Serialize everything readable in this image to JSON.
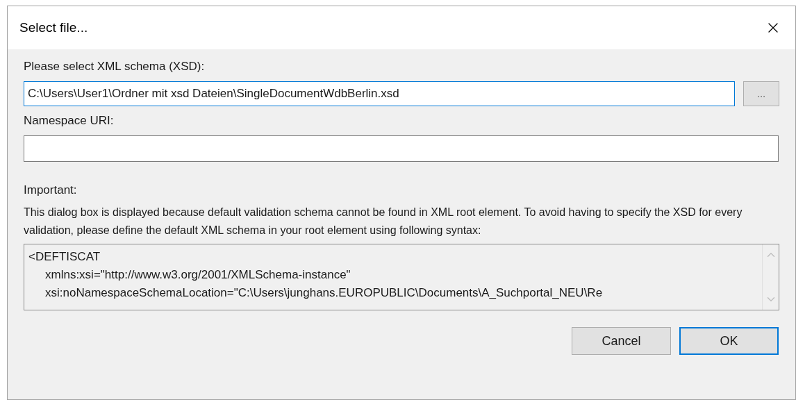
{
  "window": {
    "title": "Select file..."
  },
  "schema": {
    "label": "Please select XML schema (XSD):",
    "value": "C:\\Users\\User1\\Ordner mit xsd Dateien\\SingleDocumentWdbBerlin.xsd",
    "browse": "..."
  },
  "namespace": {
    "label": "Namespace URI:"
  },
  "important": {
    "label": "Important:",
    "text": "This dialog box is displayed because default validation schema cannot be found in XML root element. To avoid having to specify the XSD for every validation, please define the default XML schema in your root element using following syntax:"
  },
  "syntax_lines": [
    {
      "text": "<DEFTISCAT",
      "indented": false
    },
    {
      "text": "xmlns:xsi=\"http://www.w3.org/2001/XMLSchema-instance\"",
      "indented": true
    },
    {
      "text": "xsi:noNamespaceSchemaLocation=\"C:\\Users\\junghans.EUROPUBLIC\\Documents\\A_Suchportal_NEU\\Re",
      "indented": true
    }
  ],
  "buttons": [
    {
      "label": "Cancel",
      "default": false
    },
    {
      "label": "OK",
      "default": true
    }
  ]
}
